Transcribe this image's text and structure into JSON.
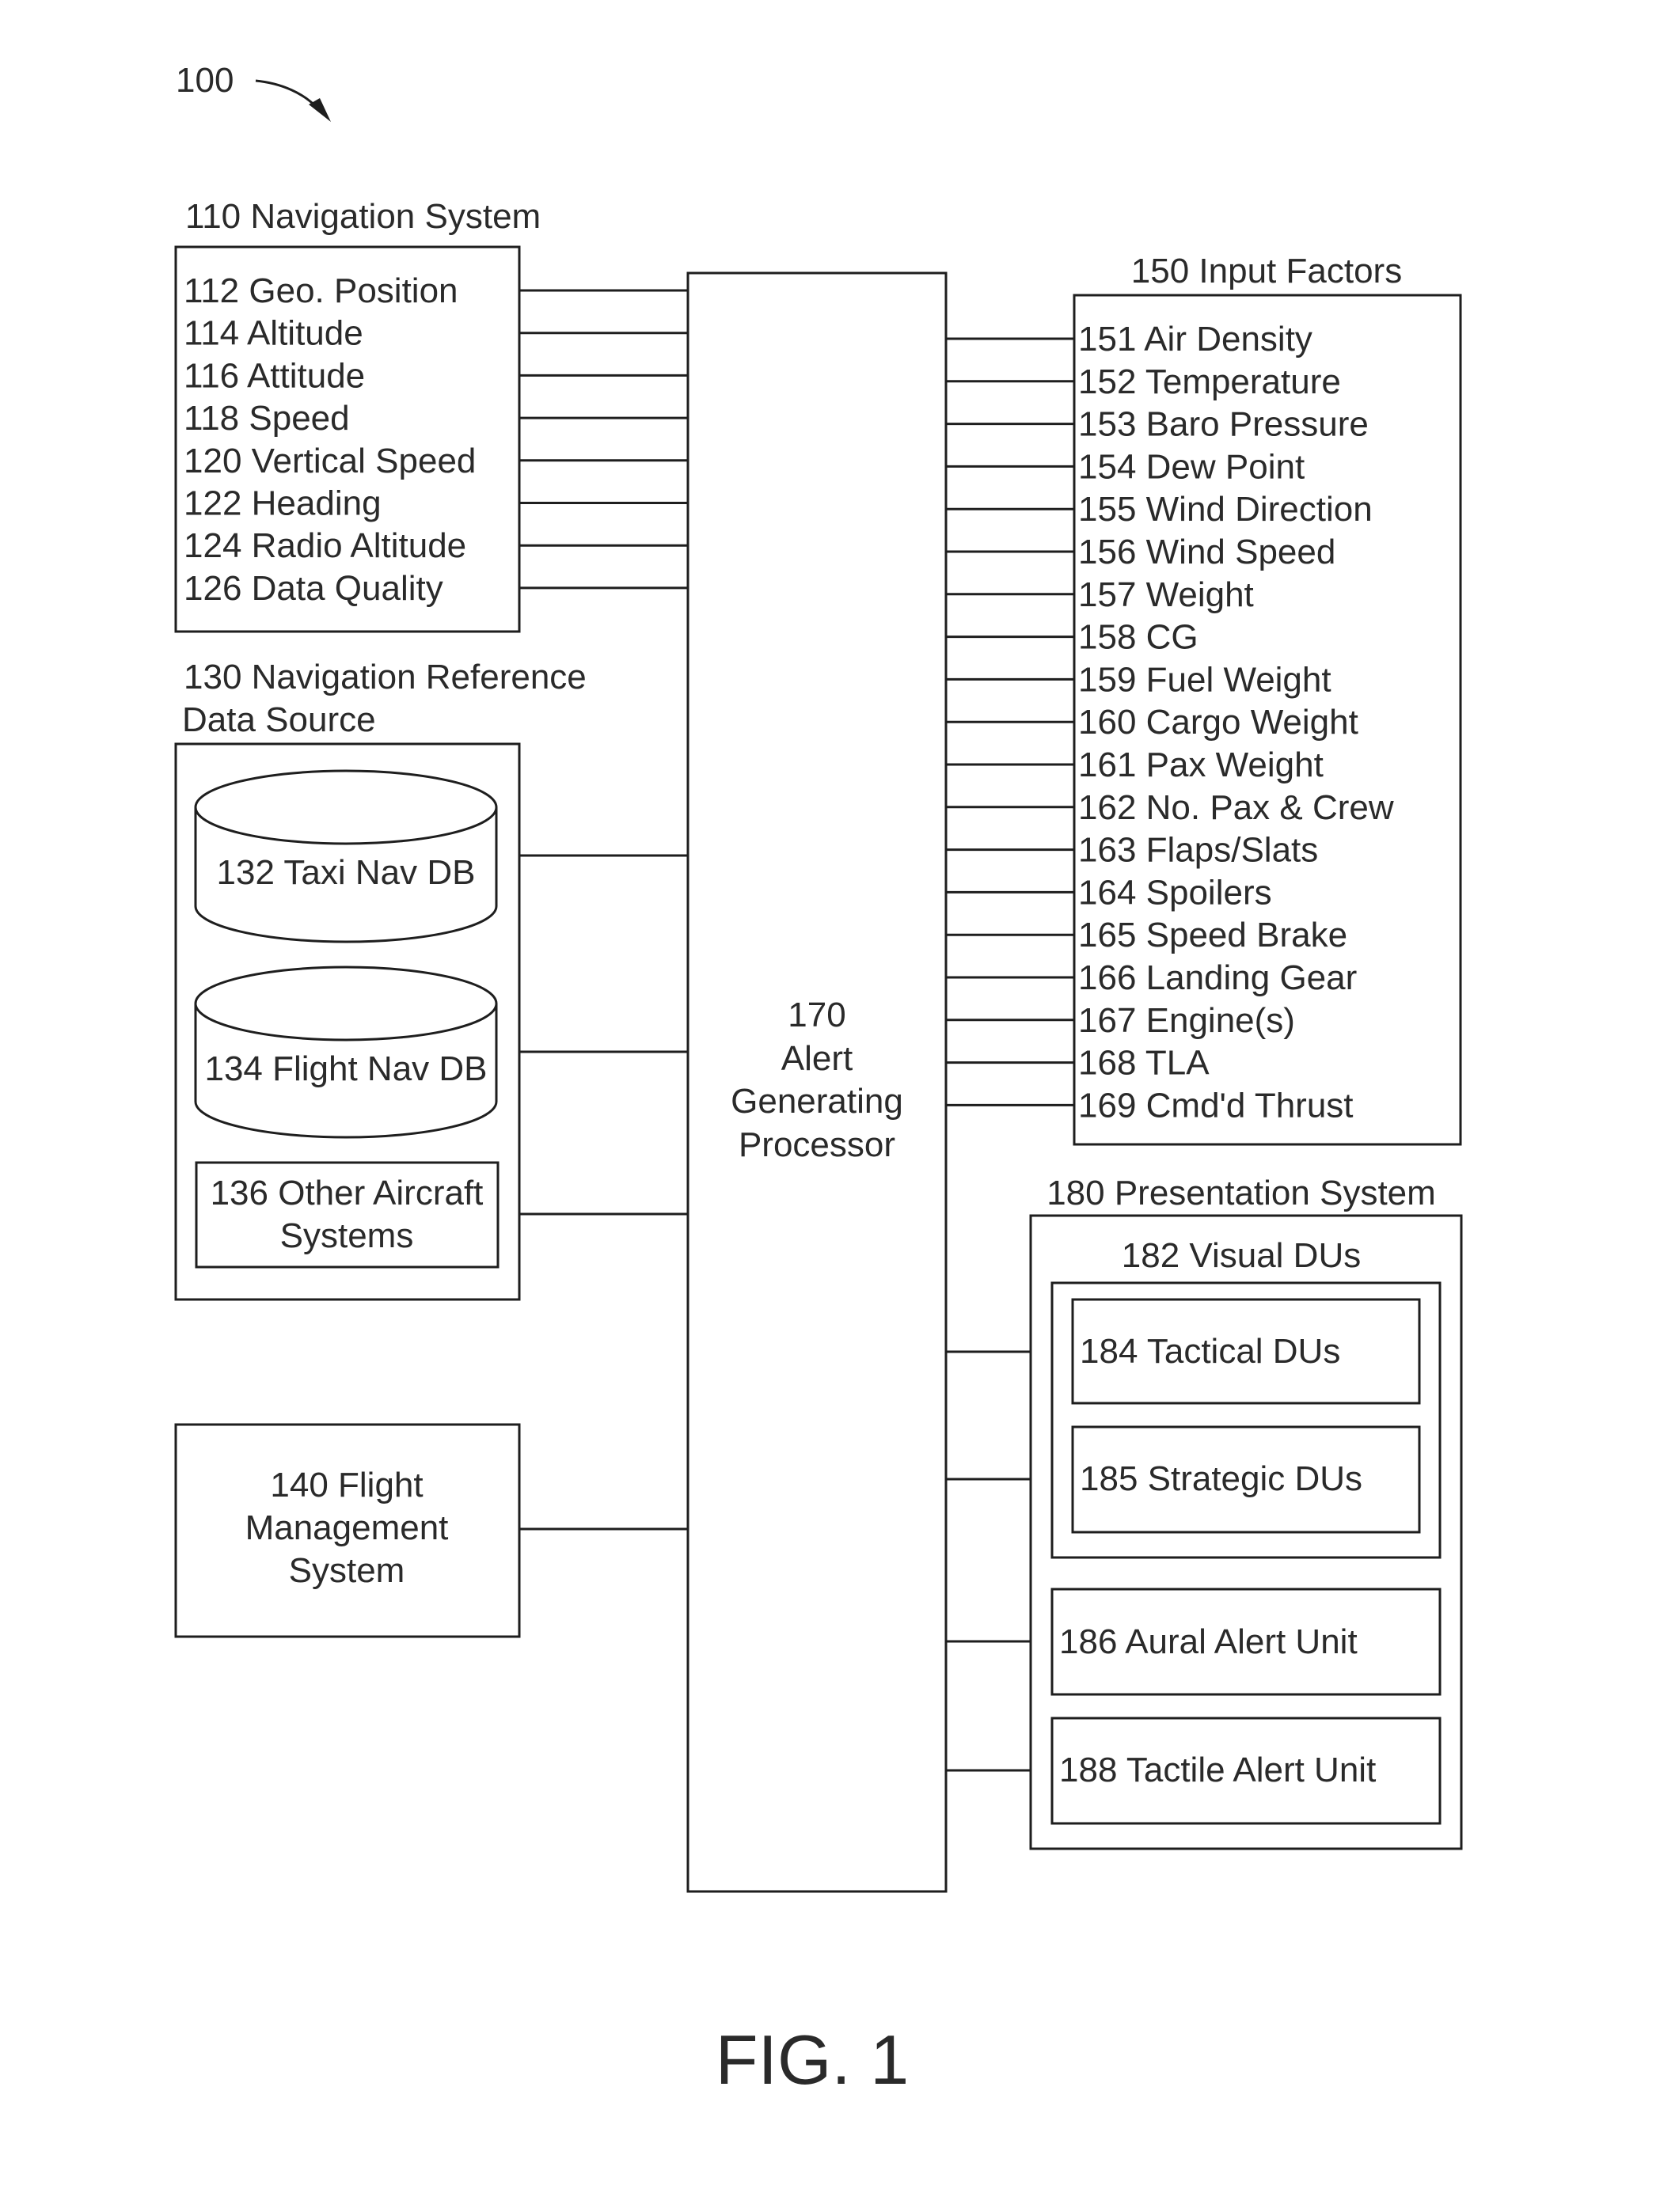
{
  "figure": {
    "ref_number": "100",
    "caption": "FIG. 1"
  },
  "navigation_system": {
    "title": "110 Navigation System",
    "items": [
      "112 Geo. Position",
      "114 Altitude",
      "116 Attitude",
      "118 Speed",
      "120 Vertical Speed",
      "122 Heading",
      "124 Radio Altitude",
      "126 Data Quality"
    ]
  },
  "nav_reference": {
    "title_line1": "130 Navigation Reference",
    "title_line2": "Data Source",
    "taxi_db": "132 Taxi Nav DB",
    "flight_db": "134 Flight Nav DB",
    "other_line1": "136 Other Aircraft",
    "other_line2": "Systems"
  },
  "fms": {
    "line1": "140 Flight",
    "line2": "Management",
    "line3": "System"
  },
  "processor": {
    "line1": "170",
    "line2": "Alert",
    "line3": "Generating",
    "line4": "Processor"
  },
  "input_factors": {
    "title": "150 Input Factors",
    "items": [
      "151 Air Density",
      "152 Temperature",
      "153 Baro Pressure",
      "154 Dew Point",
      "155 Wind Direction",
      "156 Wind Speed",
      "157 Weight",
      "158 CG",
      "159 Fuel Weight",
      "160 Cargo Weight",
      "161 Pax Weight",
      "162 No. Pax & Crew",
      "163 Flaps/Slats",
      "164 Spoilers",
      "165 Speed Brake",
      "166 Landing Gear",
      "167 Engine(s)",
      "168 TLA",
      "169 Cmd'd Thrust"
    ]
  },
  "presentation": {
    "title": "180 Presentation System",
    "visual_title": "182 Visual DUs",
    "tactical": "184 Tactical DUs",
    "strategic": "185 Strategic DUs",
    "aural": "186 Aural Alert Unit",
    "tactile": "188 Tactile Alert Unit"
  }
}
